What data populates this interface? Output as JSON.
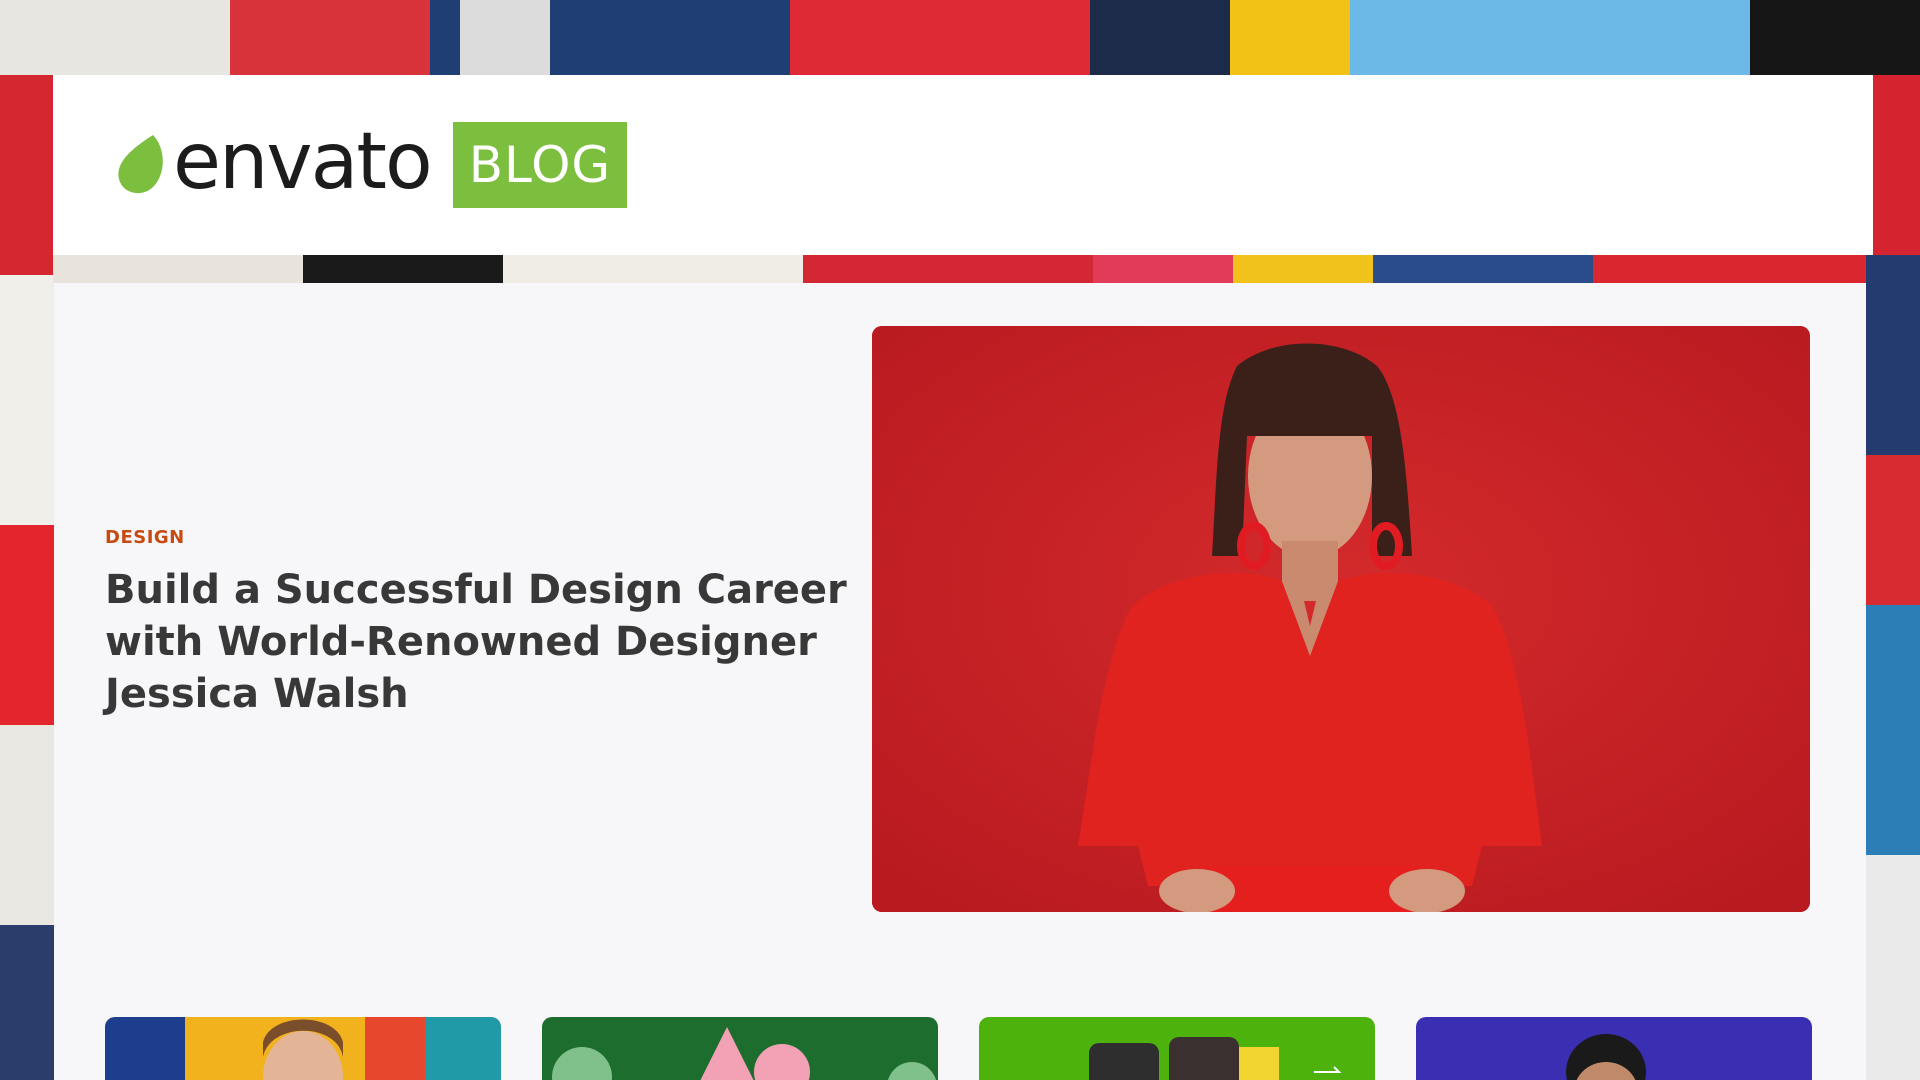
{
  "brand": {
    "wordmark": "envato",
    "badge": "BLOG",
    "leaf_color": "#7cbe3d",
    "badge_color": "#7cbe3d"
  },
  "background": {
    "description_colors": [
      "#d7262f",
      "#1f3a6b",
      "#f2c316",
      "#e4e4e4",
      "#4fa3d8",
      "#111111"
    ]
  },
  "featured": {
    "category": "DESIGN",
    "title": "Build a Successful Design Career with World-Renowned Designer Jessica Walsh",
    "category_color": "#c74b11",
    "image_icon": "portrait-photo"
  },
  "cards": [
    {
      "image_icon": "portrait-photo"
    },
    {
      "image_icon": "illustration-image"
    },
    {
      "image_icon": "phones-image"
    },
    {
      "image_icon": "portrait-photo"
    }
  ]
}
